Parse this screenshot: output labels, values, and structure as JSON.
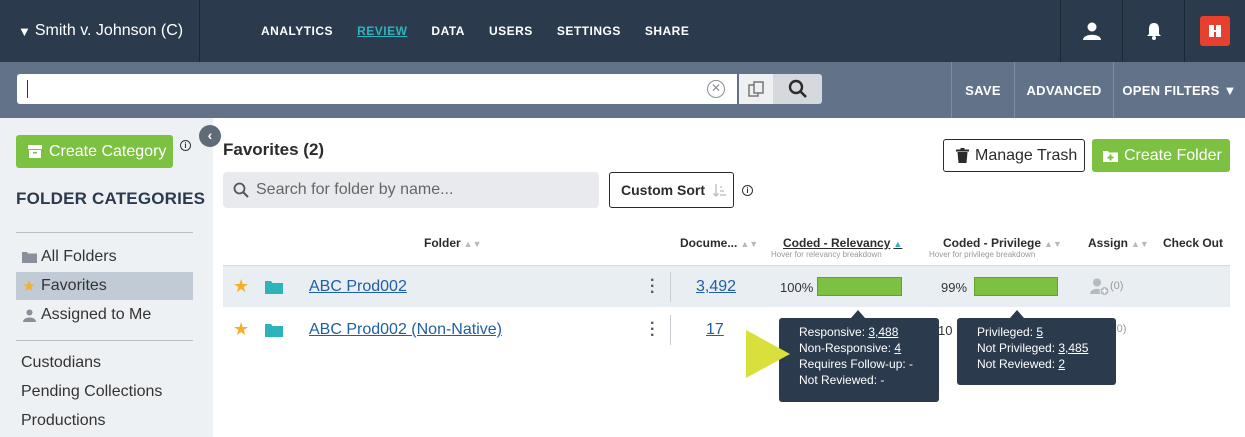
{
  "topbar": {
    "case_name": "Smith v. Johnson (C)",
    "nav": [
      "ANALYTICS",
      "REVIEW",
      "DATA",
      "USERS",
      "SETTINGS",
      "SHARE"
    ],
    "active_nav": "REVIEW",
    "brand_accent": "#e8402f"
  },
  "searchbar": {
    "query": "",
    "save_label": "SAVE",
    "advanced_label": "ADVANCED",
    "open_filters_label": "OPEN FILTERS ▼"
  },
  "sidebar": {
    "create_category_label": "Create Category",
    "title": "FOLDER CATEGORIES",
    "items": [
      {
        "label": "All Folders",
        "icon": "folder-icon"
      },
      {
        "label": "Favorites",
        "icon": "star-icon",
        "selected": true
      },
      {
        "label": "Assigned to Me",
        "icon": "user-icon"
      }
    ],
    "links": [
      "Custodians",
      "Pending Collections",
      "Productions"
    ]
  },
  "main": {
    "title": "Favorites (2)",
    "search_placeholder": "Search for folder by name...",
    "custom_sort_label": "Custom Sort",
    "manage_trash_label": "Manage Trash",
    "create_folder_label": "Create Folder",
    "columns": {
      "folder": "Folder",
      "documents": "Docume...",
      "relevancy": "Coded - Relevancy",
      "relevancy_hint": "Hover for relevancy breakdown",
      "privilege": "Coded - Privilege",
      "privilege_hint": "Hover for privilege breakdown",
      "assign": "Assign",
      "checkout": "Check Out"
    },
    "rows": [
      {
        "name": "ABC Prod002",
        "documents": "3,492",
        "relevancy_pct": "100%",
        "privilege_pct": "99%",
        "relevancy_value": 100,
        "privilege_value": 99,
        "assign_count": "(0)"
      },
      {
        "name": "ABC Prod002 (Non-Native)",
        "documents": "17",
        "assign_count": "(0)"
      }
    ]
  },
  "tooltips": {
    "relevancy": {
      "responsive_label": "Responsive: ",
      "responsive_value": "3,488",
      "nonresponsive_label": "Non-Responsive: ",
      "nonresponsive_value": "4",
      "followup": "Requires Follow-up: -",
      "notreviewed": "Not Reviewed: -"
    },
    "privilege": {
      "privileged_label": "Privileged: ",
      "privileged_value": "5",
      "notprivileged_label": "Not Privileged: ",
      "notprivileged_value": "3,485",
      "notreviewed_label": "Not Reviewed: ",
      "notreviewed_value": "2"
    }
  },
  "colors": {
    "accent_green": "#7dc142",
    "link_blue": "#1f5fa6",
    "teal": "#2fb3bb",
    "navy": "#2c3a4d",
    "highlight_arrow": "#d9df3b"
  }
}
